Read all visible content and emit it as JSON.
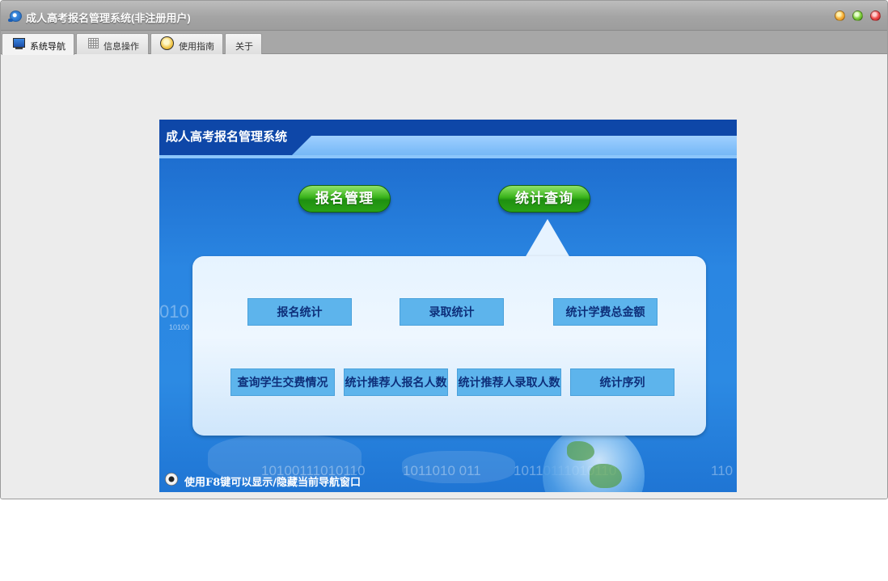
{
  "window": {
    "title": "成人高考报名管理系统(非注册用户)"
  },
  "tabs": [
    {
      "label": "系统导航",
      "icon": "monitor-icon"
    },
    {
      "label": "信息操作",
      "icon": "grid-icon"
    },
    {
      "label": "使用指南",
      "icon": "help-icon"
    },
    {
      "label": "关于"
    }
  ],
  "banner": {
    "title": "成人高考报名管理系统",
    "pills": {
      "registration": "报名管理",
      "statistics": "统计查询"
    },
    "buttons": [
      "报名统计",
      "录取统计",
      "统计学费总金额",
      "查询学生交费情况",
      "统计推荐人报名人数",
      "统计推荐人录取人数",
      "统计序列"
    ],
    "footer_note": "使用F8键可以显示/隐藏当前导航窗口",
    "deco": {
      "bits_left_big": "010",
      "bits_left_small": "10100",
      "bits_bottom_1": "1010011101011​0",
      "bits_bottom_2": "1011010  011",
      "bits_bottom_3": "1011011101011​0",
      "bits_bottom_4": "110"
    }
  },
  "colors": {
    "accent_green": "#38b21a",
    "banner_blue": "#2a86e2",
    "button_blue": "#5db4ec",
    "button_text": "#0e2f7a"
  }
}
